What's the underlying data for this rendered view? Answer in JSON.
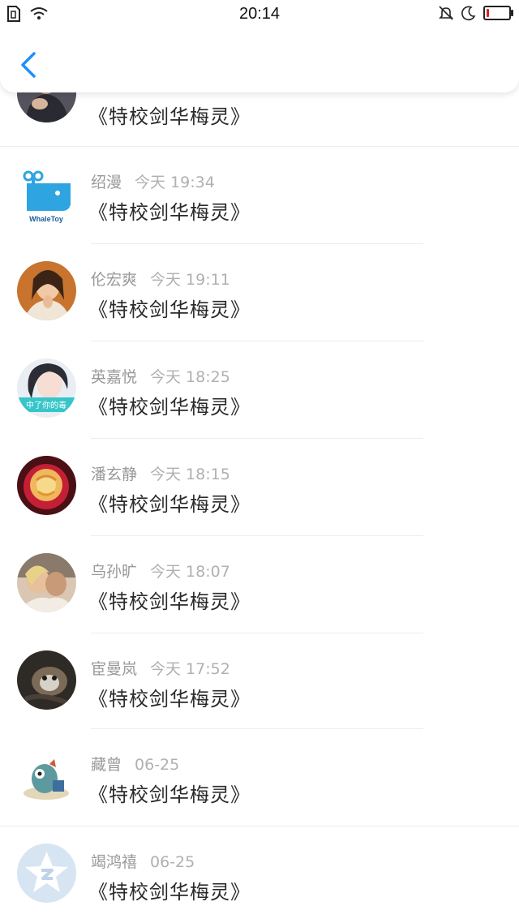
{
  "status_bar": {
    "time": "20:14",
    "left_icons": [
      "sim-card-icon",
      "wifi-icon"
    ],
    "right_icons": [
      "mute-bell-icon",
      "moon-icon",
      "battery-icon"
    ],
    "battery_level": 0.08,
    "battery_color": "#e02020"
  },
  "header": {
    "back_icon": "chevron-left-icon",
    "accent": "#1e90ff"
  },
  "items": [
    {
      "name": "",
      "time": "",
      "title": "《特校剑华梅灵》",
      "avatar": "avatar-photo-person"
    },
    {
      "name": "绍漫",
      "time": "今天 19:34",
      "title": "《特校剑华梅灵》",
      "avatar": "avatar-whaletoy-logo",
      "avatar_text": "WhaleToy"
    },
    {
      "name": "伦宏爽",
      "time": "今天 19:11",
      "title": "《特校剑华梅灵》",
      "avatar": "avatar-photo-girl"
    },
    {
      "name": "英嘉悦",
      "time": "今天 18:25",
      "title": "《特校剑华梅灵》",
      "avatar": "avatar-anime-girl",
      "avatar_text": "中了你的毒"
    },
    {
      "name": "潘玄静",
      "time": "今天 18:15",
      "title": "《特校剑华梅灵》",
      "avatar": "avatar-rose-flower"
    },
    {
      "name": "乌孙旷",
      "time": "今天 18:07",
      "title": "《特校剑华梅灵》",
      "avatar": "avatar-photo-couple"
    },
    {
      "name": "宦曼岚",
      "time": "今天 17:52",
      "title": "《特校剑华梅灵》",
      "avatar": "avatar-photo-cat"
    },
    {
      "name": "藏曾",
      "time": "06-25",
      "title": "《特校剑华梅灵》",
      "avatar": "avatar-cartoon-dino"
    },
    {
      "name": "竭鸿禧",
      "time": "06-25",
      "title": "《特校剑华梅灵》",
      "avatar": "avatar-default-star"
    }
  ]
}
